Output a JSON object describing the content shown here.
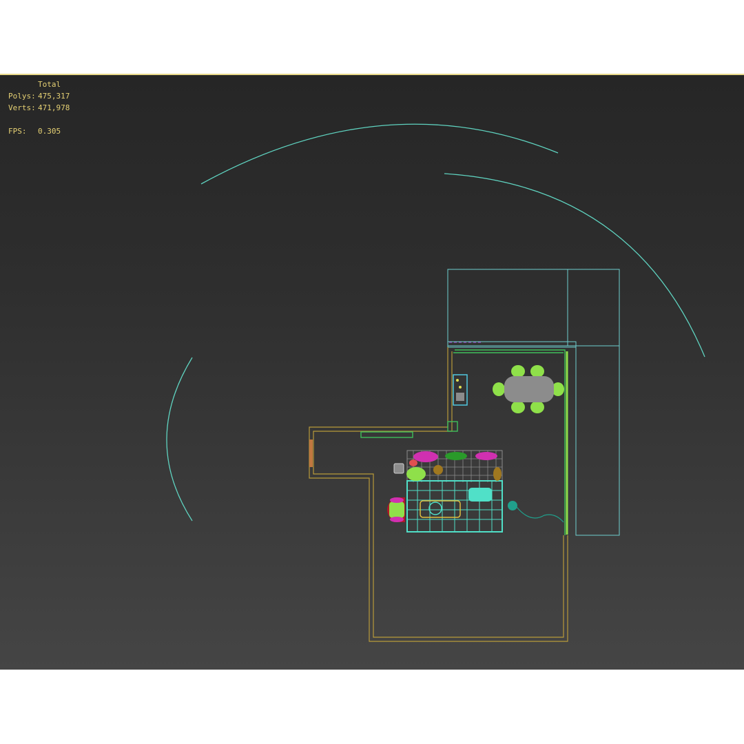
{
  "stats": {
    "header": "Total",
    "polys_label": "Polys:",
    "polys_value": "475,317",
    "verts_label": "Verts:",
    "verts_value": "471,978",
    "fps_label": "FPS:",
    "fps_value": "0.305"
  },
  "colors": {
    "viewport_top": "#262626",
    "viewport_bottom": "#454545",
    "frame_highlight": "#e9d98a",
    "stats_text": "#e6d174",
    "camera_arc": "#5fd3c0",
    "walls_outer": "#b89a3a",
    "walls_inner": "#3fbf5a",
    "box_outline": "#6fd0d0",
    "chairs": "#8fe04a",
    "table": "#8c8c8c",
    "magenta": "#d030b0",
    "cyan": "#50e0c8"
  }
}
